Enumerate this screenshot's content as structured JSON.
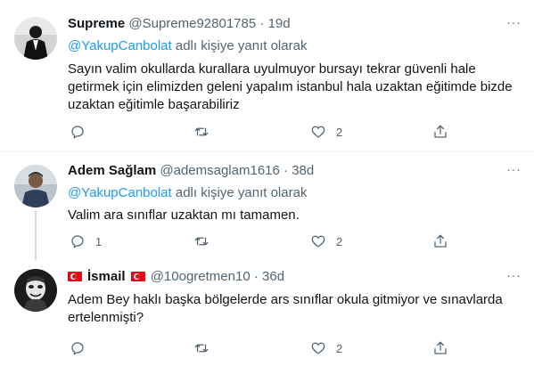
{
  "tweets": [
    {
      "name": "Supreme",
      "handle": "@Supreme92801785",
      "separator": "·",
      "time": "19d",
      "reply_mention": "@YakupCanbolat",
      "reply_suffix": " adlı kişiye yanıt olarak",
      "text_lines": [
        "Sayın valim okullarda kurallara uyulmuyor bursayı tekrar güvenli hale",
        "getirmek için elimizden geleni yapalım istanbul hala uzaktan eğitimde bizde",
        "uzaktan eğitimle başarabiliriz"
      ],
      "reply_count": "",
      "retweet_count": "",
      "like_count": "2"
    },
    {
      "name": "Adem Sağlam",
      "handle": "@ademsaglam1616",
      "separator": "·",
      "time": "38d",
      "reply_mention": "@YakupCanbolat",
      "reply_suffix": " adlı kişiye yanıt olarak",
      "text_lines": [
        "Valim ara sınıflar uzaktan mı tamamen."
      ],
      "reply_count": "1",
      "retweet_count": "",
      "like_count": "2"
    },
    {
      "name": "İsmail",
      "handle": "@10ogretmen10",
      "separator": "·",
      "time": "36d",
      "text_lines": [
        "Adem Bey haklı başka bölgelerde ars sınıflar okula gitmiyor ve sınavlarda",
        "ertelenmişti?"
      ],
      "reply_count": "",
      "retweet_count": "",
      "like_count": "2"
    }
  ],
  "more_label": "···",
  "icons": {
    "reply": "reply-icon",
    "retweet": "retweet-icon",
    "like": "heart-icon",
    "share": "share-icon",
    "flag": "turkey-flag-icon"
  },
  "colors": {
    "link": "#1d9bf0",
    "secondary": "#536471",
    "divider": "#eff3f4"
  }
}
